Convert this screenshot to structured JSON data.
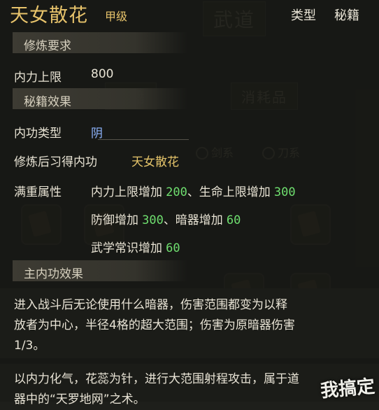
{
  "title": {
    "name": "天女散花",
    "grade": "甲级"
  },
  "type": {
    "label": "类型",
    "value": "秘籍"
  },
  "background": {
    "tabs": [
      "武道",
      "秘籍",
      "消耗品"
    ],
    "filters": [
      "剑系",
      "刀系"
    ]
  },
  "requirements": {
    "header": "修炼要求",
    "rows": [
      {
        "label": "内力上限",
        "value": "800"
      }
    ]
  },
  "effects": {
    "header": "秘籍效果",
    "internal_type_label": "内功类型",
    "internal_type_value": "阴",
    "learn_label": "修炼后习得内功",
    "learn_value": "天女散花",
    "attr_label": "满重属性",
    "attributes": [
      [
        {
          "name": "内力上限增加",
          "amount": "200"
        },
        {
          "name": "、生命上限增加",
          "amount": "300"
        }
      ],
      [
        {
          "name": "防御增加",
          "amount": "300"
        },
        {
          "name": "、暗器增加",
          "amount": "60"
        }
      ],
      [
        {
          "name": "武学常识增加",
          "amount": "60"
        }
      ]
    ]
  },
  "main_effect": {
    "header": "主内功效果",
    "lines": [
      "进入战斗后无论使用什么暗器，伤害范围都变为以释",
      "放者为中心，半径4格的超大范围；伤害为原暗器伤害",
      "1/3。"
    ]
  },
  "lore": {
    "lines": [
      "以内力化气，花蕊为针，进行大范围射程攻击，属于道",
      "器中的“天罗地网”之术。"
    ]
  },
  "watermark": "我搞定"
}
